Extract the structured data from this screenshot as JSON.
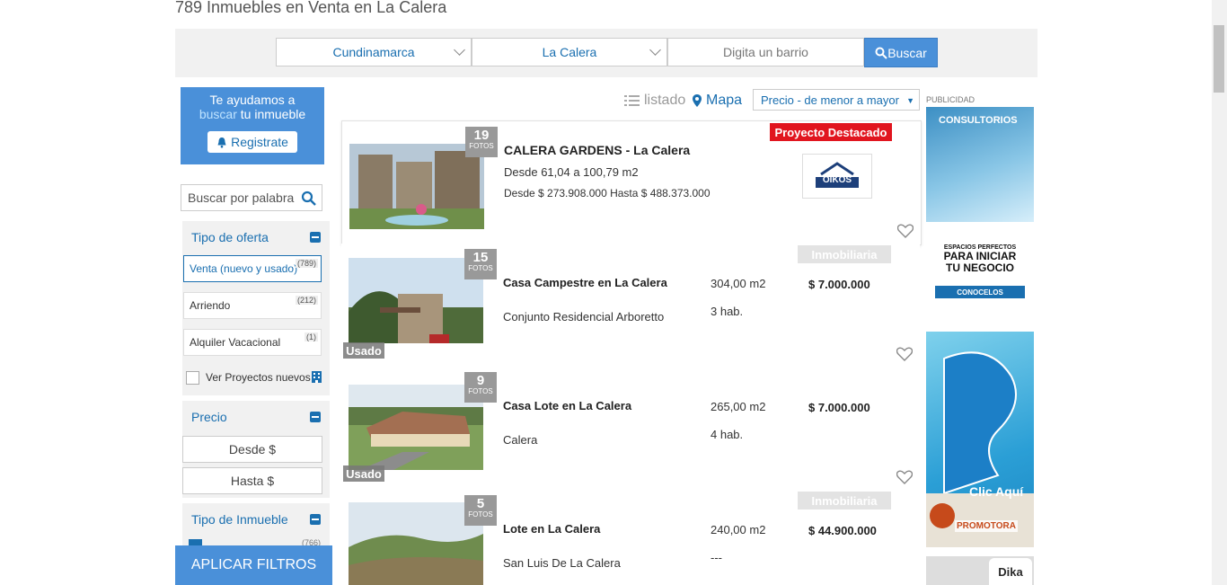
{
  "page_title": "789 Inmuebles en Venta en La Calera",
  "search": {
    "department": "Cundinamarca",
    "city": "La Calera",
    "barrio_placeholder": "Digita un barrio",
    "button": "Buscar"
  },
  "help_box": {
    "line1": "Te ayudamos a",
    "accent": "buscar",
    "rest": " tu inmueble",
    "register": "Registrate"
  },
  "keyword_search": {
    "placeholder": "Buscar por palabra"
  },
  "filters": {
    "offer": {
      "title": "Tipo de oferta",
      "options": [
        {
          "label": "Venta (nuevo y usado)",
          "count": "(789)"
        },
        {
          "label": "Arriendo",
          "count": "(212)"
        },
        {
          "label": "Alquiler Vacacional",
          "count": "(1)"
        }
      ],
      "new_projects": "Ver Proyectos nuevos"
    },
    "price": {
      "title": "Precio",
      "from": "Desde $",
      "to": "Hasta $"
    },
    "property_type": {
      "title": "Tipo de Inmueble",
      "count": "(766)"
    }
  },
  "apply_button": "APLICAR FILTROS",
  "views": {
    "list": "listado",
    "map": "Mapa"
  },
  "sort": "Precio - de menor a mayor",
  "ads": {
    "label": "PUBLICIDAD",
    "ad1": "CONSULTORIOS",
    "ad2_l1": "ESPACIOS PERFECTOS",
    "ad2_l2": "PARA INICIAR",
    "ad2_l3": "TU NEGOCIO",
    "ad2_cta": "CONOCELOS",
    "ad3_cta": "Clic Aquí",
    "ad3_brand": "PROMOTORA",
    "ad4": "Dika"
  },
  "listings": [
    {
      "photos": "19",
      "photos_label": "FOTOS",
      "title": "CALERA GARDENS - La Calera",
      "area": "Desde 61,04 a 100,79 m2",
      "price": "Desde $ 273.908.000 Hasta $ 488.373.000",
      "tag": "Proyecto Destacado",
      "logo": "OIKOS"
    },
    {
      "photos": "15",
      "photos_label": "FOTOS",
      "title": "Casa Campestre en La Calera",
      "location": "Conjunto Residencial Arboretto",
      "area": "304,00 m2",
      "rooms": "3 hab.",
      "price": "$ 7.000.000",
      "tag": "Inmobiliaria",
      "condition": "Usado"
    },
    {
      "photos": "9",
      "photos_label": "FOTOS",
      "title": "Casa Lote en La Calera",
      "location": "Calera",
      "area": "265,00 m2",
      "rooms": "4 hab.",
      "price": "$ 7.000.000",
      "condition": "Usado"
    },
    {
      "photos": "5",
      "photos_label": "FOTOS",
      "title": "Lote en La Calera",
      "location": "San Luis De La Calera",
      "area": "240,00 m2",
      "rooms": "---",
      "price": "$ 44.900.000",
      "tag": "Inmobiliaria"
    }
  ]
}
